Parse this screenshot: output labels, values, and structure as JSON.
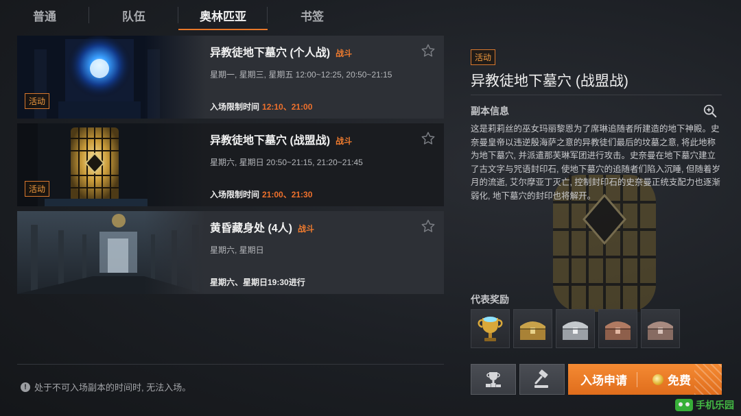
{
  "tabs": [
    {
      "label": "普通",
      "active": false
    },
    {
      "label": "队伍",
      "active": false
    },
    {
      "label": "奥林匹亚",
      "active": true
    },
    {
      "label": "书签",
      "active": false
    }
  ],
  "dungeons": [
    {
      "title": "异教徒地下墓穴 (个人战)",
      "tag": "战斗",
      "badge": "活动",
      "days": "星期一, 星期三, 星期五  12:00~12:25, 20:50~21:15",
      "limit_label": "入场限制时间",
      "limit_time": "12:10、21:00",
      "image": "blue-portal"
    },
    {
      "title": "异教徒地下墓穴 (战盟战)",
      "tag": "战斗",
      "badge": "活动",
      "days": "星期六, 星期日  20:50~21:15, 21:20~21:45",
      "limit_label": "入场限制时间",
      "limit_time": "21:00、21:30",
      "image": "sealed-gate",
      "selected": true
    },
    {
      "title": "黄昏藏身处 (4人)",
      "tag": "战斗",
      "days": "星期六, 星期日",
      "limit_label": "星期六、星期日19:30进行",
      "image": "hall"
    }
  ],
  "notice": "处于不可入场副本的时间时, 无法入场。",
  "detail": {
    "badge": "活动",
    "title": "异教徒地下墓穴 (战盟战)",
    "info_label": "副本信息",
    "description": "这是莉莉丝的巫女玛丽黎恩为了席琳追随者所建造的地下神殿。史奈曼皇帝以违逆殷海萨之意的异教徒们最后的坟墓之意, 将此地称为地下墓穴, 并派遣那芙琳军团进行攻击。史奈曼在地下墓穴建立了古文字与咒语封印石, 使地下墓穴的追随者们陷入沉睡, 但随着岁月的流逝, 艾尔摩亚丁灭亡, 控制封印石的史奈曼正统支配力也逐渐弱化, 地下墓穴的封印也将解开。",
    "rewards_label": "代表奖励",
    "rewards": [
      "trophy-icon",
      "gold-chest-icon",
      "silver-chest-icon",
      "bronze-chest-icon",
      "copper-chest-icon"
    ],
    "enter_label": "入场申请",
    "free_label": "免费"
  },
  "watermark": "手机乐园",
  "colors": {
    "accent": "#ef7b2e",
    "panel": "#2d3036",
    "background": "#1c1f24"
  }
}
